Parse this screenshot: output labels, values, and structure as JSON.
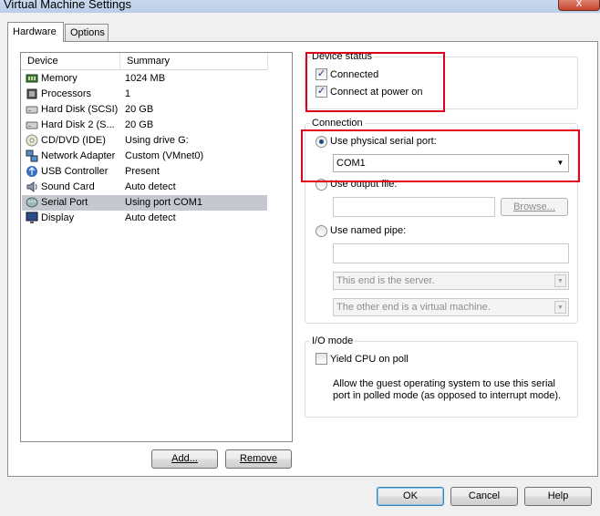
{
  "window": {
    "title": "Virtual Machine Settings",
    "close": "x"
  },
  "tabs": {
    "hardware": "Hardware",
    "options": "Options"
  },
  "device_list": {
    "columns": {
      "device": "Device",
      "summary": "Summary"
    },
    "rows": [
      {
        "device": "Memory",
        "summary": "1024 MB",
        "icon": "memory-icon"
      },
      {
        "device": "Processors",
        "summary": "1",
        "icon": "processor-icon"
      },
      {
        "device": "Hard Disk (SCSI)",
        "summary": "20 GB",
        "icon": "hard-disk-icon"
      },
      {
        "device": "Hard Disk 2 (S...",
        "summary": "20 GB",
        "icon": "hard-disk-icon"
      },
      {
        "device": "CD/DVD (IDE)",
        "summary": "Using drive G:",
        "icon": "cd-dvd-icon"
      },
      {
        "device": "Network Adapter",
        "summary": "Custom (VMnet0)",
        "icon": "network-adapter-icon"
      },
      {
        "device": "USB Controller",
        "summary": "Present",
        "icon": "usb-icon"
      },
      {
        "device": "Sound Card",
        "summary": "Auto detect",
        "icon": "sound-card-icon"
      },
      {
        "device": "Serial Port",
        "summary": "Using port COM1",
        "icon": "serial-port-icon"
      },
      {
        "device": "Display",
        "summary": "Auto detect",
        "icon": "display-icon"
      }
    ],
    "selected": "Serial Port"
  },
  "buttons": {
    "add": "Add...",
    "remove": "Remove",
    "ok": "OK",
    "cancel": "Cancel",
    "help": "Help",
    "browse": "Browse..."
  },
  "device_status": {
    "title": "Device status",
    "connected": "Connected",
    "connect_at_power_on": "Connect at power on"
  },
  "connection": {
    "title": "Connection",
    "use_physical": "Use physical serial port:",
    "physical_port_value": "COM1",
    "use_output_file": "Use output file:",
    "use_named_pipe": "Use named pipe:",
    "pipe_end_value": "This end is the server.",
    "pipe_other_value": "The other end is a virtual machine."
  },
  "io_mode": {
    "title": "I/O mode",
    "yield_cpu": "Yield CPU on poll",
    "description": "Allow the guest operating system to use this serial port in polled mode (as opposed to interrupt mode)."
  },
  "colors": {
    "highlight": "#e0001a",
    "selection": "#c5c9cf"
  }
}
